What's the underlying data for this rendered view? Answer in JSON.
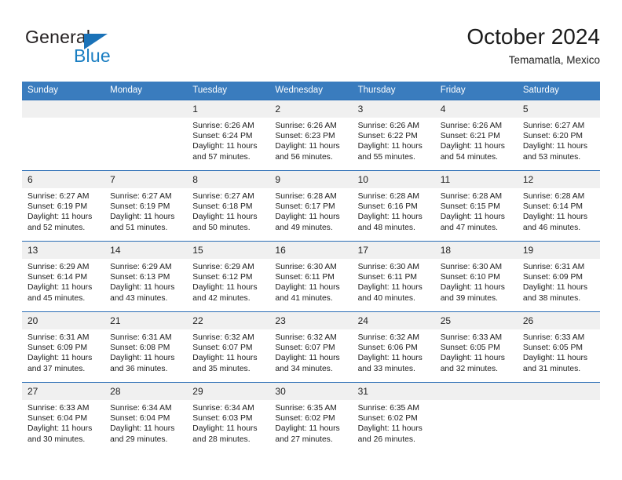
{
  "brand": {
    "word_one": "General",
    "word_two": "Blue",
    "triangle_icon": "brand-triangle-icon",
    "accent_color": "#1a7ec2"
  },
  "header": {
    "title": "October 2024",
    "subtitle": "Temamatla, Mexico"
  },
  "calendar": {
    "header_color": "#3a7cbe",
    "separator_color": "#2a6db5",
    "daynum_bg": "#f0f0f0",
    "weekday_headers": [
      "Sunday",
      "Monday",
      "Tuesday",
      "Wednesday",
      "Thursday",
      "Friday",
      "Saturday"
    ],
    "weeks": [
      [
        {
          "day": "",
          "sunrise": "",
          "sunset": "",
          "daylight_line1": "",
          "daylight_line2": ""
        },
        {
          "day": "",
          "sunrise": "",
          "sunset": "",
          "daylight_line1": "",
          "daylight_line2": ""
        },
        {
          "day": "1",
          "sunrise": "Sunrise: 6:26 AM",
          "sunset": "Sunset: 6:24 PM",
          "daylight_line1": "Daylight: 11 hours",
          "daylight_line2": "and 57 minutes."
        },
        {
          "day": "2",
          "sunrise": "Sunrise: 6:26 AM",
          "sunset": "Sunset: 6:23 PM",
          "daylight_line1": "Daylight: 11 hours",
          "daylight_line2": "and 56 minutes."
        },
        {
          "day": "3",
          "sunrise": "Sunrise: 6:26 AM",
          "sunset": "Sunset: 6:22 PM",
          "daylight_line1": "Daylight: 11 hours",
          "daylight_line2": "and 55 minutes."
        },
        {
          "day": "4",
          "sunrise": "Sunrise: 6:26 AM",
          "sunset": "Sunset: 6:21 PM",
          "daylight_line1": "Daylight: 11 hours",
          "daylight_line2": "and 54 minutes."
        },
        {
          "day": "5",
          "sunrise": "Sunrise: 6:27 AM",
          "sunset": "Sunset: 6:20 PM",
          "daylight_line1": "Daylight: 11 hours",
          "daylight_line2": "and 53 minutes."
        }
      ],
      [
        {
          "day": "6",
          "sunrise": "Sunrise: 6:27 AM",
          "sunset": "Sunset: 6:19 PM",
          "daylight_line1": "Daylight: 11 hours",
          "daylight_line2": "and 52 minutes."
        },
        {
          "day": "7",
          "sunrise": "Sunrise: 6:27 AM",
          "sunset": "Sunset: 6:19 PM",
          "daylight_line1": "Daylight: 11 hours",
          "daylight_line2": "and 51 minutes."
        },
        {
          "day": "8",
          "sunrise": "Sunrise: 6:27 AM",
          "sunset": "Sunset: 6:18 PM",
          "daylight_line1": "Daylight: 11 hours",
          "daylight_line2": "and 50 minutes."
        },
        {
          "day": "9",
          "sunrise": "Sunrise: 6:28 AM",
          "sunset": "Sunset: 6:17 PM",
          "daylight_line1": "Daylight: 11 hours",
          "daylight_line2": "and 49 minutes."
        },
        {
          "day": "10",
          "sunrise": "Sunrise: 6:28 AM",
          "sunset": "Sunset: 6:16 PM",
          "daylight_line1": "Daylight: 11 hours",
          "daylight_line2": "and 48 minutes."
        },
        {
          "day": "11",
          "sunrise": "Sunrise: 6:28 AM",
          "sunset": "Sunset: 6:15 PM",
          "daylight_line1": "Daylight: 11 hours",
          "daylight_line2": "and 47 minutes."
        },
        {
          "day": "12",
          "sunrise": "Sunrise: 6:28 AM",
          "sunset": "Sunset: 6:14 PM",
          "daylight_line1": "Daylight: 11 hours",
          "daylight_line2": "and 46 minutes."
        }
      ],
      [
        {
          "day": "13",
          "sunrise": "Sunrise: 6:29 AM",
          "sunset": "Sunset: 6:14 PM",
          "daylight_line1": "Daylight: 11 hours",
          "daylight_line2": "and 45 minutes."
        },
        {
          "day": "14",
          "sunrise": "Sunrise: 6:29 AM",
          "sunset": "Sunset: 6:13 PM",
          "daylight_line1": "Daylight: 11 hours",
          "daylight_line2": "and 43 minutes."
        },
        {
          "day": "15",
          "sunrise": "Sunrise: 6:29 AM",
          "sunset": "Sunset: 6:12 PM",
          "daylight_line1": "Daylight: 11 hours",
          "daylight_line2": "and 42 minutes."
        },
        {
          "day": "16",
          "sunrise": "Sunrise: 6:30 AM",
          "sunset": "Sunset: 6:11 PM",
          "daylight_line1": "Daylight: 11 hours",
          "daylight_line2": "and 41 minutes."
        },
        {
          "day": "17",
          "sunrise": "Sunrise: 6:30 AM",
          "sunset": "Sunset: 6:11 PM",
          "daylight_line1": "Daylight: 11 hours",
          "daylight_line2": "and 40 minutes."
        },
        {
          "day": "18",
          "sunrise": "Sunrise: 6:30 AM",
          "sunset": "Sunset: 6:10 PM",
          "daylight_line1": "Daylight: 11 hours",
          "daylight_line2": "and 39 minutes."
        },
        {
          "day": "19",
          "sunrise": "Sunrise: 6:31 AM",
          "sunset": "Sunset: 6:09 PM",
          "daylight_line1": "Daylight: 11 hours",
          "daylight_line2": "and 38 minutes."
        }
      ],
      [
        {
          "day": "20",
          "sunrise": "Sunrise: 6:31 AM",
          "sunset": "Sunset: 6:09 PM",
          "daylight_line1": "Daylight: 11 hours",
          "daylight_line2": "and 37 minutes."
        },
        {
          "day": "21",
          "sunrise": "Sunrise: 6:31 AM",
          "sunset": "Sunset: 6:08 PM",
          "daylight_line1": "Daylight: 11 hours",
          "daylight_line2": "and 36 minutes."
        },
        {
          "day": "22",
          "sunrise": "Sunrise: 6:32 AM",
          "sunset": "Sunset: 6:07 PM",
          "daylight_line1": "Daylight: 11 hours",
          "daylight_line2": "and 35 minutes."
        },
        {
          "day": "23",
          "sunrise": "Sunrise: 6:32 AM",
          "sunset": "Sunset: 6:07 PM",
          "daylight_line1": "Daylight: 11 hours",
          "daylight_line2": "and 34 minutes."
        },
        {
          "day": "24",
          "sunrise": "Sunrise: 6:32 AM",
          "sunset": "Sunset: 6:06 PM",
          "daylight_line1": "Daylight: 11 hours",
          "daylight_line2": "and 33 minutes."
        },
        {
          "day": "25",
          "sunrise": "Sunrise: 6:33 AM",
          "sunset": "Sunset: 6:05 PM",
          "daylight_line1": "Daylight: 11 hours",
          "daylight_line2": "and 32 minutes."
        },
        {
          "day": "26",
          "sunrise": "Sunrise: 6:33 AM",
          "sunset": "Sunset: 6:05 PM",
          "daylight_line1": "Daylight: 11 hours",
          "daylight_line2": "and 31 minutes."
        }
      ],
      [
        {
          "day": "27",
          "sunrise": "Sunrise: 6:33 AM",
          "sunset": "Sunset: 6:04 PM",
          "daylight_line1": "Daylight: 11 hours",
          "daylight_line2": "and 30 minutes."
        },
        {
          "day": "28",
          "sunrise": "Sunrise: 6:34 AM",
          "sunset": "Sunset: 6:04 PM",
          "daylight_line1": "Daylight: 11 hours",
          "daylight_line2": "and 29 minutes."
        },
        {
          "day": "29",
          "sunrise": "Sunrise: 6:34 AM",
          "sunset": "Sunset: 6:03 PM",
          "daylight_line1": "Daylight: 11 hours",
          "daylight_line2": "and 28 minutes."
        },
        {
          "day": "30",
          "sunrise": "Sunrise: 6:35 AM",
          "sunset": "Sunset: 6:02 PM",
          "daylight_line1": "Daylight: 11 hours",
          "daylight_line2": "and 27 minutes."
        },
        {
          "day": "31",
          "sunrise": "Sunrise: 6:35 AM",
          "sunset": "Sunset: 6:02 PM",
          "daylight_line1": "Daylight: 11 hours",
          "daylight_line2": "and 26 minutes."
        },
        {
          "day": "",
          "sunrise": "",
          "sunset": "",
          "daylight_line1": "",
          "daylight_line2": ""
        },
        {
          "day": "",
          "sunrise": "",
          "sunset": "",
          "daylight_line1": "",
          "daylight_line2": ""
        }
      ]
    ]
  }
}
